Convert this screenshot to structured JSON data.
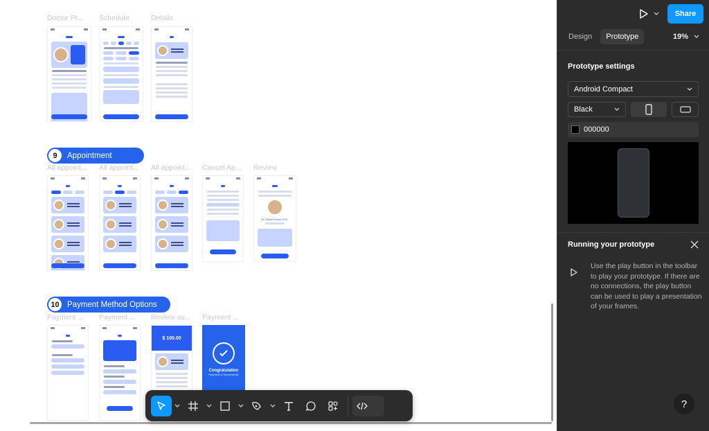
{
  "canvas": {
    "row1_labels": [
      "Doctor Pr...",
      "Schedule",
      "Details"
    ],
    "section9": {
      "number": "9",
      "title": "Appointment"
    },
    "row2_labels": [
      "All appoint...",
      "All appoint...",
      "All appoint...",
      "Cancel Ap...",
      "Review"
    ],
    "section10": {
      "number": "10",
      "title": "Payment Method Options"
    },
    "row3_labels": [
      "Payment ...",
      "Payment ...",
      "Review su...",
      "Payment ..."
    ],
    "payment_amount": "$ 100.00",
    "congrats_title": "Congratulation",
    "congrats_sub": "Payment is Successfully",
    "review_name": "Dr. Olivia Turner, M.D."
  },
  "toolbar": {
    "tools": [
      "move-tool",
      "frame-tool",
      "shape-tool",
      "pen-tool",
      "text-tool",
      "comment-tool",
      "actions-tool",
      "dev-mode-toggle"
    ]
  },
  "panel": {
    "share_label": "Share",
    "tab_design": "Design",
    "tab_prototype": "Prototype",
    "zoom": "19%",
    "settings_title": "Prototype settings",
    "device": "Android Compact",
    "color_model": "Black",
    "bg_color": "000000",
    "running_title": "Running your prototype",
    "running_text": "Use the play button in the toolbar to play your prototype. If there are no connections, the play button can be used to play a presentation of your frames.",
    "help": "?"
  },
  "colors": {
    "accent": "#0d99ff",
    "brand_blue": "#2563eb",
    "panel_bg": "#2c2c2c"
  }
}
